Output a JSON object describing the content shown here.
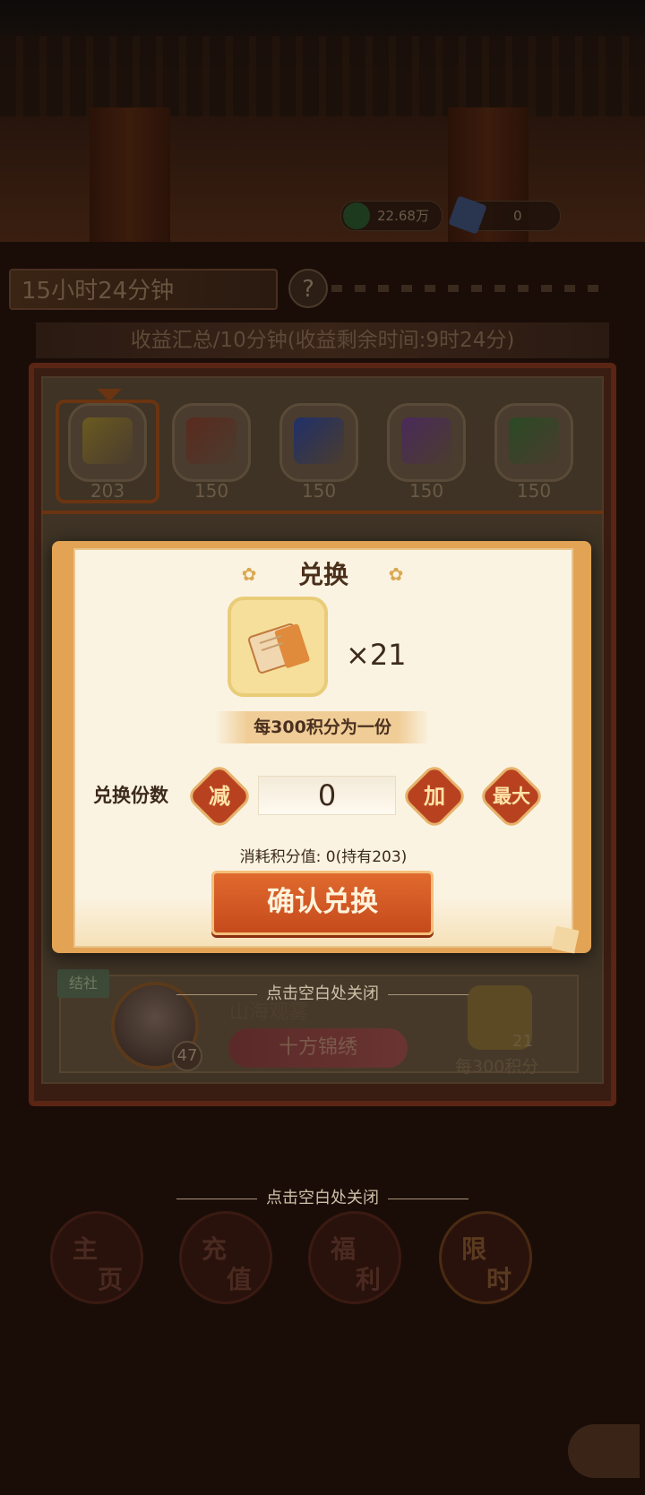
{
  "currencies": [
    {
      "icon": "coin-icon",
      "value": "22.68万"
    },
    {
      "icon": "ticket-icon",
      "value": "0"
    }
  ],
  "timer": "15小时24分钟",
  "help_icon": "question-icon",
  "income_header": "收益汇总/10分钟(收益剩余时间:9时24分)",
  "tabs": [
    {
      "count": "203",
      "color": "#6a5a20"
    },
    {
      "count": "150",
      "color": "#5a2a1e"
    },
    {
      "count": "150",
      "color": "#20306a"
    },
    {
      "count": "150",
      "color": "#4a2a5a"
    },
    {
      "count": "150",
      "color": "#2a4a24"
    }
  ],
  "list_row": {
    "tag": "结社",
    "level": "47",
    "name": "山海观雾",
    "badge": "十方锦绣",
    "item_count": "21",
    "cost": "每300积分"
  },
  "modal": {
    "title": "兑换",
    "item_qty": "×21",
    "rate_text": "每300积分为一份",
    "qty_label": "兑换份数",
    "minus_label": "减",
    "plus_label": "加",
    "max_label": "最大",
    "qty_value": "0",
    "cost_text": "消耗积分值: 0(持有203)",
    "confirm_label": "确认兑换"
  },
  "close_hint_modal": "点击空白处关闭",
  "close_hint_panel": "点击空白处关闭",
  "bottom_nav": [
    {
      "top": "主",
      "bottom": "页"
    },
    {
      "top": "充",
      "bottom": "值"
    },
    {
      "top": "福",
      "bottom": "利"
    },
    {
      "top": "限",
      "bottom": "时"
    }
  ]
}
